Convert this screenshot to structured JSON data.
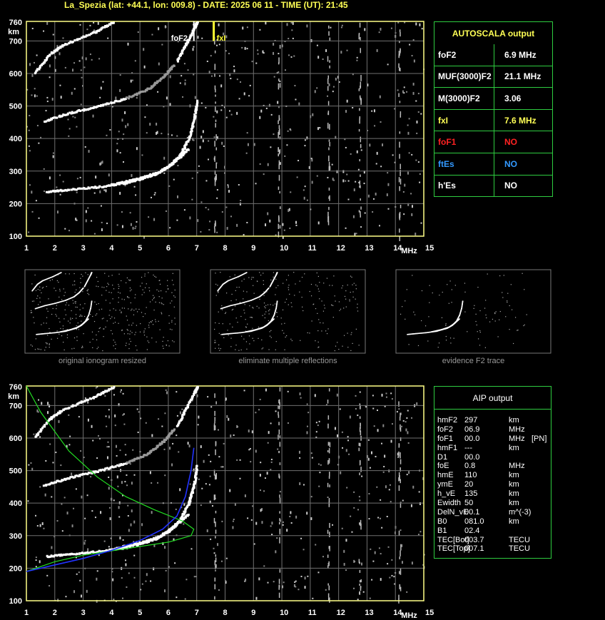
{
  "header": {
    "title": "La_Spezia (lat: +44.1, lon: 009.8) - DATE: 2025 06 11 - TIME (UT): 21:45"
  },
  "axes": {
    "y_unit": "km",
    "x_unit": "MHz",
    "y_ticks": [
      "100",
      "200",
      "300",
      "400",
      "500",
      "600",
      "700",
      "760"
    ],
    "x_ticks": [
      "1",
      "2",
      "3",
      "4",
      "5",
      "6",
      "7",
      "8",
      "9",
      "10",
      "11",
      "12",
      "13",
      "14",
      "15"
    ]
  },
  "markers": {
    "foF2_label": "foF2",
    "fxI_label": "fxI"
  },
  "autoscala": {
    "title": "AUTOSCALA output",
    "rows": [
      {
        "key": "foF2",
        "value": "6.9 MHz",
        "key_color": "#ffffff",
        "value_color": "#ffffff"
      },
      {
        "key": "MUF(3000)F2",
        "value": "21.1 MHz",
        "key_color": "#ffffff",
        "value_color": "#ffffff"
      },
      {
        "key": "M(3000)F2",
        "value": "3.06",
        "key_color": "#ffffff",
        "value_color": "#ffffff"
      },
      {
        "key": "fxI",
        "value": "7.6 MHz",
        "key_color": "#ffff55",
        "value_color": "#ffff55"
      },
      {
        "key": "foF1",
        "value": "NO",
        "key_color": "#ff2222",
        "value_color": "#ff2222"
      },
      {
        "key": "ftEs",
        "value": "NO",
        "key_color": "#3399ff",
        "value_color": "#3399ff"
      },
      {
        "key": "h'Es",
        "value": "NO",
        "key_color": "#ffffff",
        "value_color": "#ffffff"
      }
    ]
  },
  "thumbnails": [
    {
      "caption": "original ionogram resized"
    },
    {
      "caption": "eliminate multiple reflections"
    },
    {
      "caption": "evidence F2 trace"
    }
  ],
  "aip": {
    "title": "AIP output",
    "rows": [
      {
        "k": "hmF2",
        "v": "297",
        "u": "km",
        "x": ""
      },
      {
        "k": "foF2",
        "v": "06.9",
        "u": "MHz",
        "x": ""
      },
      {
        "k": "foF1",
        "v": "00.0",
        "u": "MHz",
        "x": "[PN]"
      },
      {
        "k": "hmF1",
        "v": "---",
        "u": "km",
        "x": ""
      },
      {
        "k": "D1",
        "v": "00.0",
        "u": "",
        "x": ""
      },
      {
        "k": "foE",
        "v": "0.8",
        "u": "MHz",
        "x": ""
      },
      {
        "k": "hmE",
        "v": "110",
        "u": "km",
        "x": ""
      },
      {
        "k": "ymE",
        "v": "20",
        "u": "km",
        "x": ""
      },
      {
        "k": "h_vE",
        "v": "135",
        "u": "km",
        "x": ""
      },
      {
        "k": "Ewidth",
        "v": "50",
        "u": "km",
        "x": ""
      },
      {
        "k": "DelN_vE",
        "v": "00.1",
        "u": "m^(-3)",
        "x": ""
      },
      {
        "k": "B0",
        "v": "081.0",
        "u": "km",
        "x": ""
      },
      {
        "k": "B1",
        "v": "02.4",
        "u": "",
        "x": ""
      },
      {
        "k": "TEC[Bot]",
        "v": "003.7",
        "u": "TECU",
        "x": ""
      },
      {
        "k": "TEC[Top]",
        "v": "007.1",
        "u": "TECU",
        "x": ""
      }
    ]
  },
  "chart_data": {
    "type": "scatter",
    "xlabel": "MHz",
    "ylabel": "km",
    "xlim": [
      1,
      15
    ],
    "ylim": [
      100,
      760
    ],
    "grid": true,
    "foF2": 6.9,
    "fxI": 7.6,
    "traces": {
      "o_low": [
        [
          1.7,
          238
        ],
        [
          2.5,
          245
        ],
        [
          3.5,
          253
        ],
        [
          4.5,
          265
        ],
        [
          5.5,
          290
        ],
        [
          6.0,
          315
        ],
        [
          6.4,
          350
        ],
        [
          6.7,
          400
        ],
        [
          6.9,
          460
        ],
        [
          7.0,
          520
        ]
      ],
      "x_low": [
        [
          4.0,
          260
        ],
        [
          5.0,
          280
        ],
        [
          5.7,
          300
        ],
        [
          6.2,
          330
        ],
        [
          6.7,
          370
        ]
      ],
      "o_mid": [
        [
          1.6,
          455
        ],
        [
          2.5,
          480
        ],
        [
          3.5,
          500
        ],
        [
          4.5,
          525
        ],
        [
          5.3,
          555
        ],
        [
          5.8,
          590
        ],
        [
          6.2,
          630
        ]
      ],
      "o_top": [
        [
          1.3,
          605
        ],
        [
          1.8,
          660
        ],
        [
          2.3,
          690
        ],
        [
          3.3,
          725
        ],
        [
          4.1,
          760
        ]
      ],
      "o_topright": [
        [
          6.3,
          640
        ],
        [
          6.6,
          690
        ],
        [
          6.9,
          740
        ],
        [
          7.0,
          760
        ]
      ]
    },
    "profiles": {
      "blue": [
        [
          1.0,
          190
        ],
        [
          2.0,
          210
        ],
        [
          3.0,
          230
        ],
        [
          4.0,
          255
        ],
        [
          5.0,
          285
        ],
        [
          5.8,
          320
        ],
        [
          6.3,
          360
        ],
        [
          6.6,
          420
        ],
        [
          6.8,
          500
        ],
        [
          6.9,
          570
        ]
      ],
      "green": [
        [
          1.0,
          760
        ],
        [
          1.5,
          680
        ],
        [
          2.5,
          560
        ],
        [
          3.5,
          480
        ],
        [
          4.5,
          420
        ],
        [
          5.5,
          380
        ],
        [
          6.5,
          345
        ],
        [
          6.9,
          320
        ],
        [
          6.8,
          300
        ],
        [
          6.0,
          280
        ],
        [
          4.5,
          260
        ],
        [
          3.0,
          240
        ],
        [
          2.0,
          220
        ],
        [
          1.0,
          190
        ]
      ]
    }
  }
}
